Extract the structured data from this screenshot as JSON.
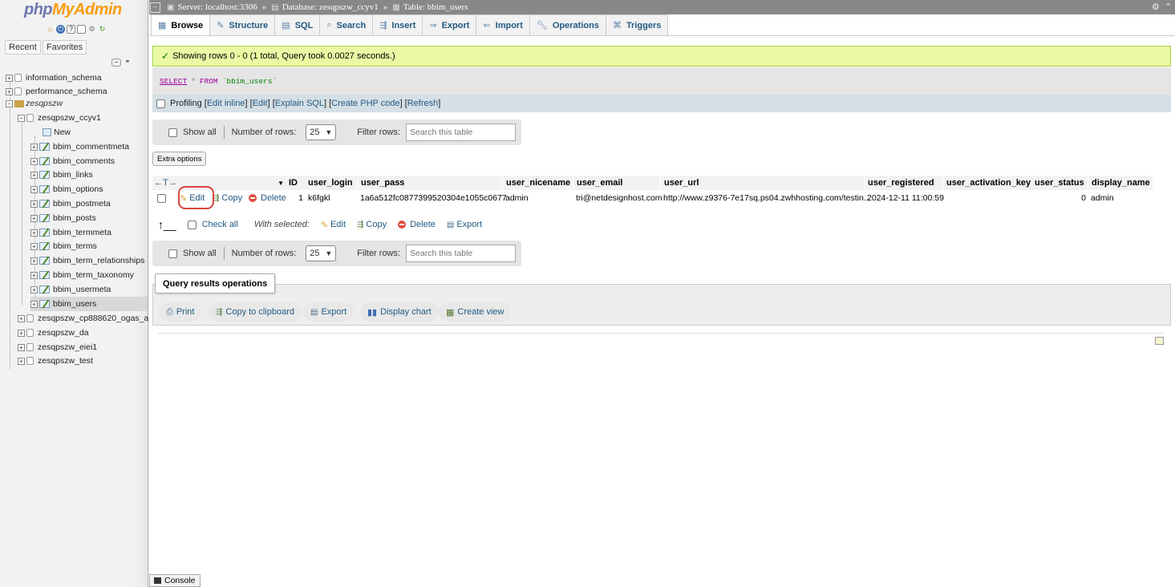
{
  "logo": {
    "php": "php",
    "myadmin": "MyAdmin"
  },
  "nav_tabs": [
    "Recent",
    "Favorites"
  ],
  "tree": {
    "dbs": [
      "information_schema",
      "performance_schema"
    ],
    "group": "zesqpszw",
    "current_db": "zesqpszw_ccyv1",
    "new_label": "New",
    "tables": [
      "bbim_commentmeta",
      "bbim_comments",
      "bbim_links",
      "bbim_options",
      "bbim_postmeta",
      "bbim_posts",
      "bbim_termmeta",
      "bbim_terms",
      "bbim_term_relationships",
      "bbim_term_taxonomy",
      "bbim_usermeta",
      "bbim_users"
    ],
    "other_dbs": [
      "zesqpszw_cp888620_ogas_a",
      "zesqpszw_da",
      "zesqpszw_eiei1",
      "zesqpszw_test"
    ]
  },
  "breadcrumb": {
    "server": "Server: localhost:3306",
    "database": "Database: zesqpszw_ccyv1",
    "table": "Table: bbim_users"
  },
  "tabs": [
    "Browse",
    "Structure",
    "SQL",
    "Search",
    "Insert",
    "Export",
    "Import",
    "Operations",
    "Triggers"
  ],
  "success_message": "Showing rows 0 - 0 (1 total, Query took 0.0027 seconds.)",
  "sql": {
    "select": "SELECT",
    "star": "*",
    "from": "FROM",
    "table": "`bbim_users`"
  },
  "profiling": {
    "label": "Profiling",
    "links": [
      "Edit inline",
      "Edit",
      "Explain SQL",
      "Create PHP code",
      "Refresh"
    ]
  },
  "navigation": {
    "show_all": "Show all",
    "number_of_rows_label": "Number of rows:",
    "number_of_rows_value": "25",
    "filter_rows_label": "Filter rows:",
    "filter_placeholder": "Search this table"
  },
  "extra_options": "Extra options",
  "table": {
    "columns": [
      "ID",
      "user_login",
      "user_pass",
      "user_nicename",
      "user_email",
      "user_url",
      "user_registered",
      "user_activation_key",
      "user_status",
      "display_name"
    ],
    "row": {
      "ID": "1",
      "user_login": "k6fgkl",
      "user_pass": "1a6a512fc0877399520304e1055c0677",
      "user_nicename": "admin",
      "user_email": "tri@netdesignhost.com",
      "user_url": "http://www.z9376-7e17sq.ps04.zwhhosting.com/testin...",
      "user_registered": "2024-12-11 11:00:59",
      "user_activation_key": "",
      "user_status": "0",
      "display_name": "admin"
    },
    "row_actions": {
      "edit": "Edit",
      "copy": "Copy",
      "delete": "Delete"
    }
  },
  "bulk": {
    "check_all": "Check all",
    "with_selected": "With selected:",
    "edit": "Edit",
    "copy": "Copy",
    "delete": "Delete",
    "export": "Export"
  },
  "query_ops": {
    "title": "Query results operations",
    "buttons": [
      "Print",
      "Copy to clipboard",
      "Export",
      "Display chart",
      "Create view"
    ]
  },
  "console": "Console",
  "colors": {
    "link": "#235a81",
    "success_bg": "#ebf8a4",
    "highlight": "#d9453b",
    "logo_php": "#6c78af",
    "logo_my": "#f89c0e"
  }
}
